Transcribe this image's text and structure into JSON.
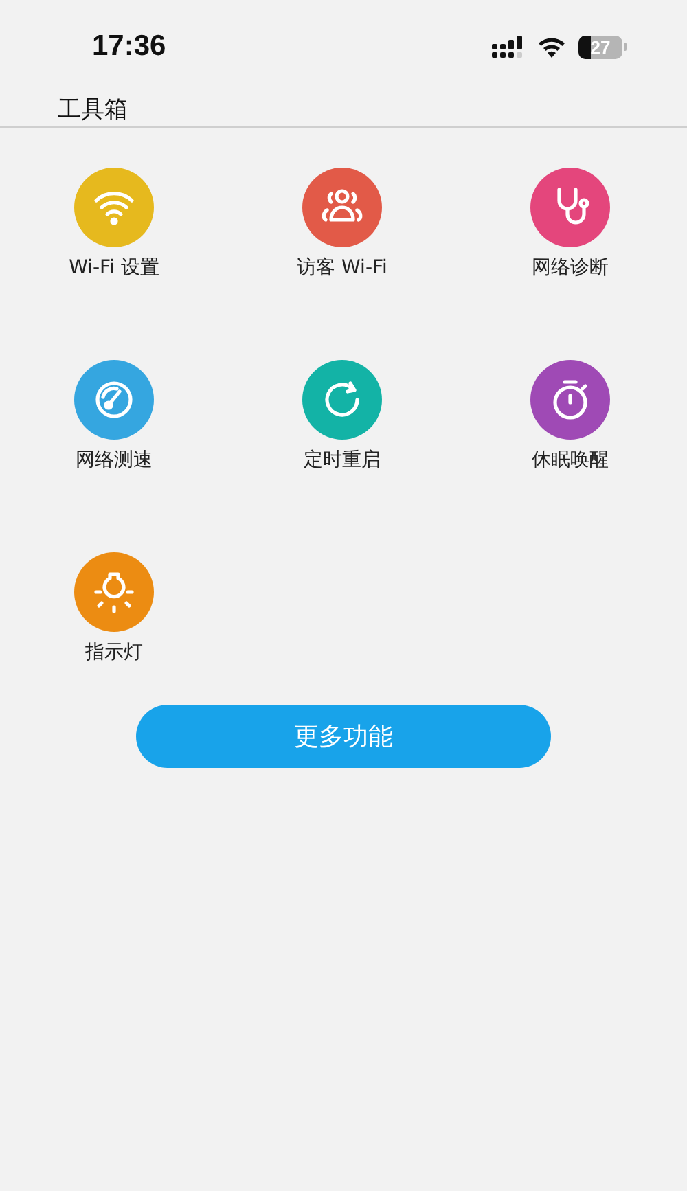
{
  "status_bar": {
    "time": "17:36",
    "battery": "27"
  },
  "title": "工具箱",
  "tools": [
    {
      "label": "Wi-Fi 设置",
      "kind": "wifi",
      "color": "#e6b91e"
    },
    {
      "label": "访客 Wi-Fi",
      "kind": "guests",
      "color": "#e25a48"
    },
    {
      "label": "网络诊断",
      "kind": "stethoscope",
      "color": "#e4467c"
    },
    {
      "label": "网络测速",
      "kind": "gauge",
      "color": "#35a6e0"
    },
    {
      "label": "定时重启",
      "kind": "restart",
      "color": "#13b3a6"
    },
    {
      "label": "休眠唤醒",
      "kind": "timer",
      "color": "#9f4ab5"
    },
    {
      "label": "指示灯",
      "kind": "bulb",
      "color": "#ec8c12"
    }
  ],
  "more_button": "更多功能"
}
